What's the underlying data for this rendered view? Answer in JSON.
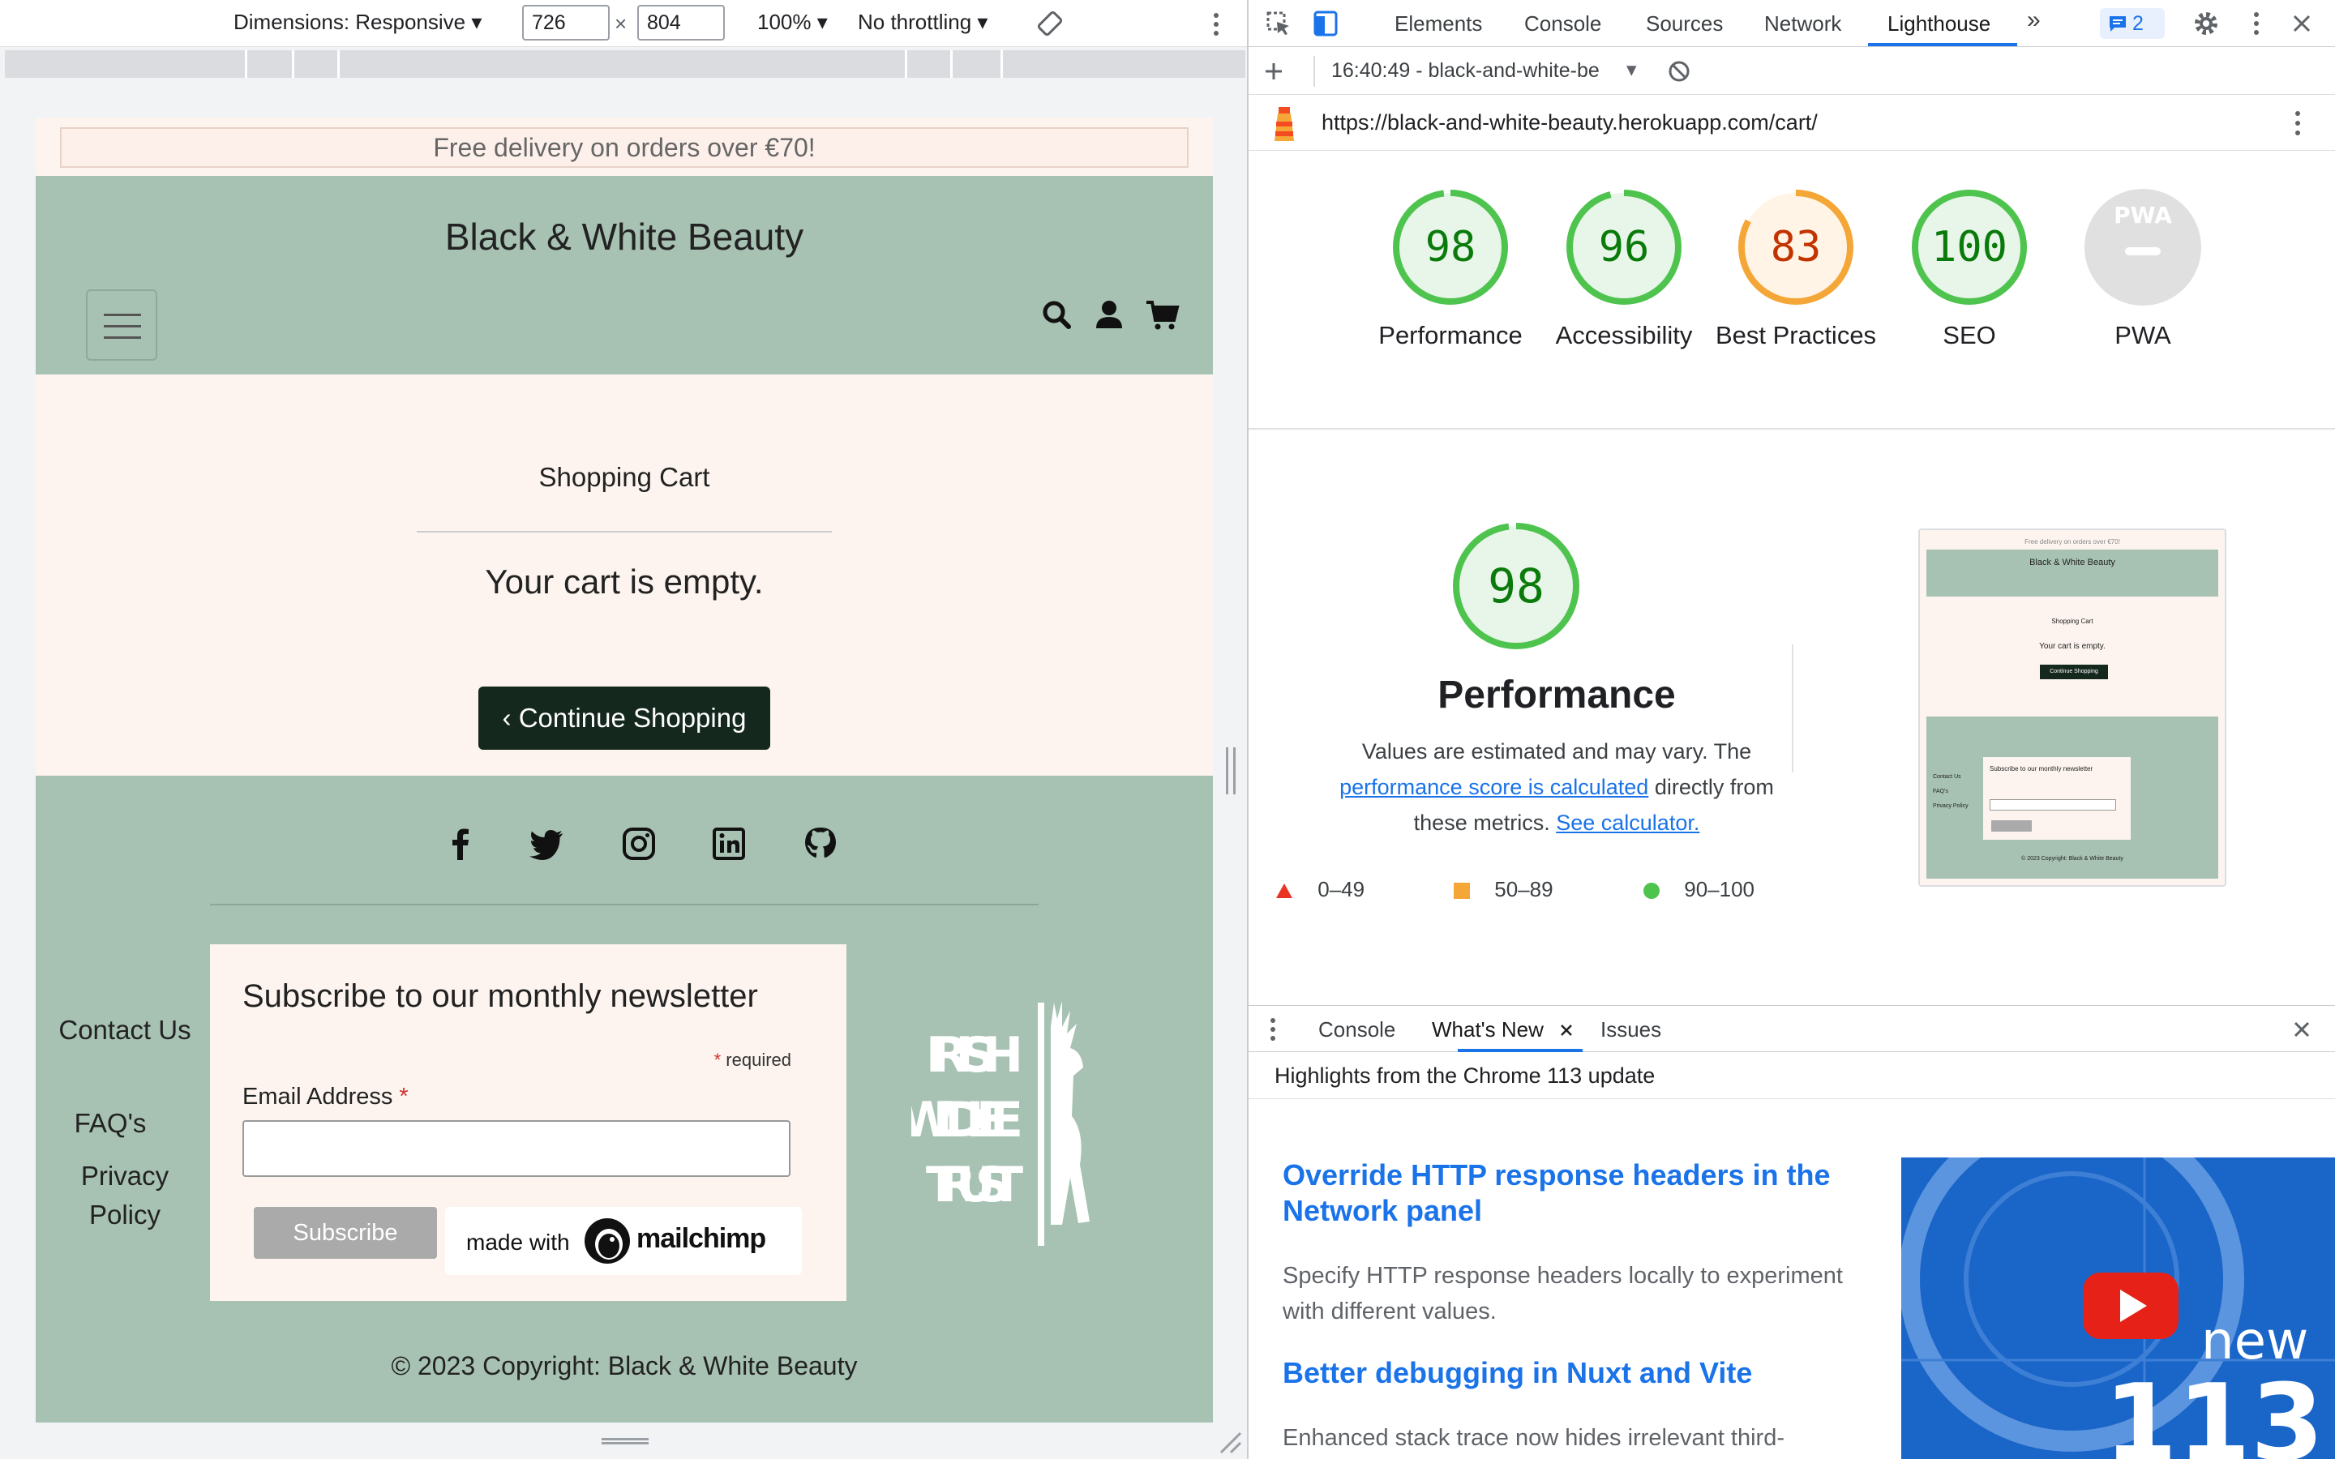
{
  "device_toolbar": {
    "dimensions_label": "Dimensions: Responsive",
    "width_value": "726",
    "times": "×",
    "height_value": "804",
    "zoom": "100%",
    "throttling": "No throttling"
  },
  "site": {
    "banner": "Free delivery on orders over €70!",
    "brand": "Black & White Beauty",
    "header_icons": [
      "search-icon",
      "user-icon",
      "cart-icon"
    ],
    "cart": {
      "title": "Shopping Cart",
      "empty_message": "Your cart is empty.",
      "continue_label": "Continue Shopping"
    },
    "footer": {
      "social_icons": [
        "facebook-icon",
        "twitter-icon",
        "instagram-icon",
        "linkedin-icon",
        "github-icon"
      ],
      "links": [
        "Contact Us",
        "FAQ's",
        "Privacy Policy"
      ],
      "newsletter": {
        "title": "Subscribe to our monthly newsletter",
        "required_note": "required",
        "required_star": "*",
        "email_label": "Email Address",
        "email_value": "",
        "subscribe_label": "Subscribe",
        "made_with": "made with",
        "mailchimp": "mailchimp"
      },
      "partner_logo_text": [
        "IRISH",
        "WILDLIFE",
        "TRUST"
      ],
      "copyright": "© 2023 Copyright: Black & White Beauty"
    }
  },
  "devtools": {
    "tabs": [
      "Elements",
      "Console",
      "Sources",
      "Network",
      "Lighthouse"
    ],
    "active_tab": "Lighthouse",
    "issues_count": "2",
    "more_tabs": "»",
    "lighthouse": {
      "report_label": "16:40:49 - black-and-white-be",
      "url": "https://black-and-white-beauty.herokuapp.com/cart/",
      "scores": [
        {
          "label": "Performance",
          "score": "98",
          "value": 98,
          "rating": "pass"
        },
        {
          "label": "Accessibility",
          "score": "96",
          "value": 96,
          "rating": "pass"
        },
        {
          "label": "Best Practices",
          "score": "83",
          "value": 83,
          "rating": "average"
        },
        {
          "label": "SEO",
          "score": "100",
          "value": 100,
          "rating": "pass"
        },
        {
          "label": "PWA",
          "score": "",
          "value": null,
          "rating": "na"
        }
      ],
      "pwa_badge": "PWA",
      "performance_detail": {
        "score": "98",
        "value": 98,
        "title": "Performance",
        "desc_1": "Values are estimated and may vary. The",
        "desc_link_1": "performance score is calculated",
        "desc_2": "directly from",
        "desc_3": "these metrics.",
        "desc_link_2": "See calculator."
      },
      "legend": [
        {
          "range": "0–49",
          "color": "#eb3323"
        },
        {
          "range": "50–89",
          "color": "#f4a637"
        },
        {
          "range": "90–100",
          "color": "#4ec44e"
        }
      ],
      "thumbnail": {
        "banner": "Free delivery on orders over €70!",
        "brand": "Black & White Beauty",
        "cart_title": "Shopping Cart",
        "empty": "Your cart is empty.",
        "continue": "Continue Shopping",
        "links": [
          "Contact Us",
          "FAQ's",
          "Privacy Policy"
        ],
        "newsletter": "Subscribe to our monthly newsletter",
        "copyright": "© 2023 Copyright: Black & White Beauty"
      }
    },
    "drawer": {
      "tabs": [
        "Console",
        "What's New",
        "Issues"
      ],
      "active_tab": "What's New",
      "subtitle": "Highlights from the Chrome 113 update",
      "items": [
        {
          "title": "Override HTTP response headers in the Network panel",
          "desc": "Specify HTTP response headers locally to experiment with different values."
        },
        {
          "title": "Better debugging in Nuxt and Vite",
          "desc": "Enhanced stack trace now hides irrelevant third-"
        }
      ],
      "promo_image_text": [
        "new",
        "113"
      ]
    }
  },
  "colors": {
    "sage": "#a7c2b3",
    "cream": "#fdf4ef",
    "dark_button": "#14281e",
    "devtools_accent": "#1a73e8",
    "pass": "#4ec44e",
    "average": "#f4a637"
  }
}
